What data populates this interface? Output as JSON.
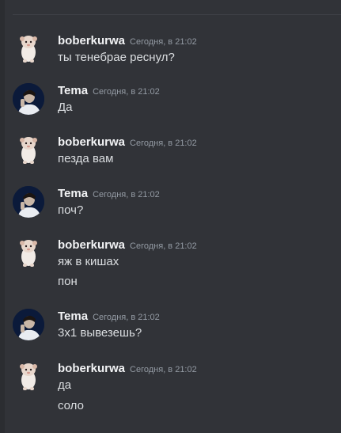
{
  "messages": [
    {
      "author": "boberkurwa",
      "time": "Сегодня, в 21:02",
      "lines": [
        "ты тенебрае реснул?"
      ],
      "avatar_icon": "hamster-avatar-icon"
    },
    {
      "author": "Tema",
      "time": "Сегодня, в 21:02",
      "lines": [
        "Да"
      ],
      "avatar_icon": "person-avatar-icon"
    },
    {
      "author": "boberkurwa",
      "time": "Сегодня, в 21:02",
      "lines": [
        "пезда вам"
      ],
      "avatar_icon": "hamster-avatar-icon"
    },
    {
      "author": "Tema",
      "time": "Сегодня, в 21:02",
      "lines": [
        "поч?"
      ],
      "avatar_icon": "person-avatar-icon"
    },
    {
      "author": "boberkurwa",
      "time": "Сегодня, в 21:02",
      "lines": [
        "яж в кишах",
        "пон"
      ],
      "avatar_icon": "hamster-avatar-icon"
    },
    {
      "author": "Tema",
      "time": "Сегодня, в 21:02",
      "lines": [
        "3х1 вывезешь?"
      ],
      "avatar_icon": "person-avatar-icon"
    },
    {
      "author": "boberkurwa",
      "time": "Сегодня, в 21:02",
      "lines": [
        "да",
        "соло"
      ],
      "avatar_icon": "hamster-avatar-icon"
    }
  ],
  "colors": {
    "background": "#313338",
    "username": "#f2f3f5",
    "timestamp": "#949ba4",
    "message_text": "#dbdee1"
  }
}
